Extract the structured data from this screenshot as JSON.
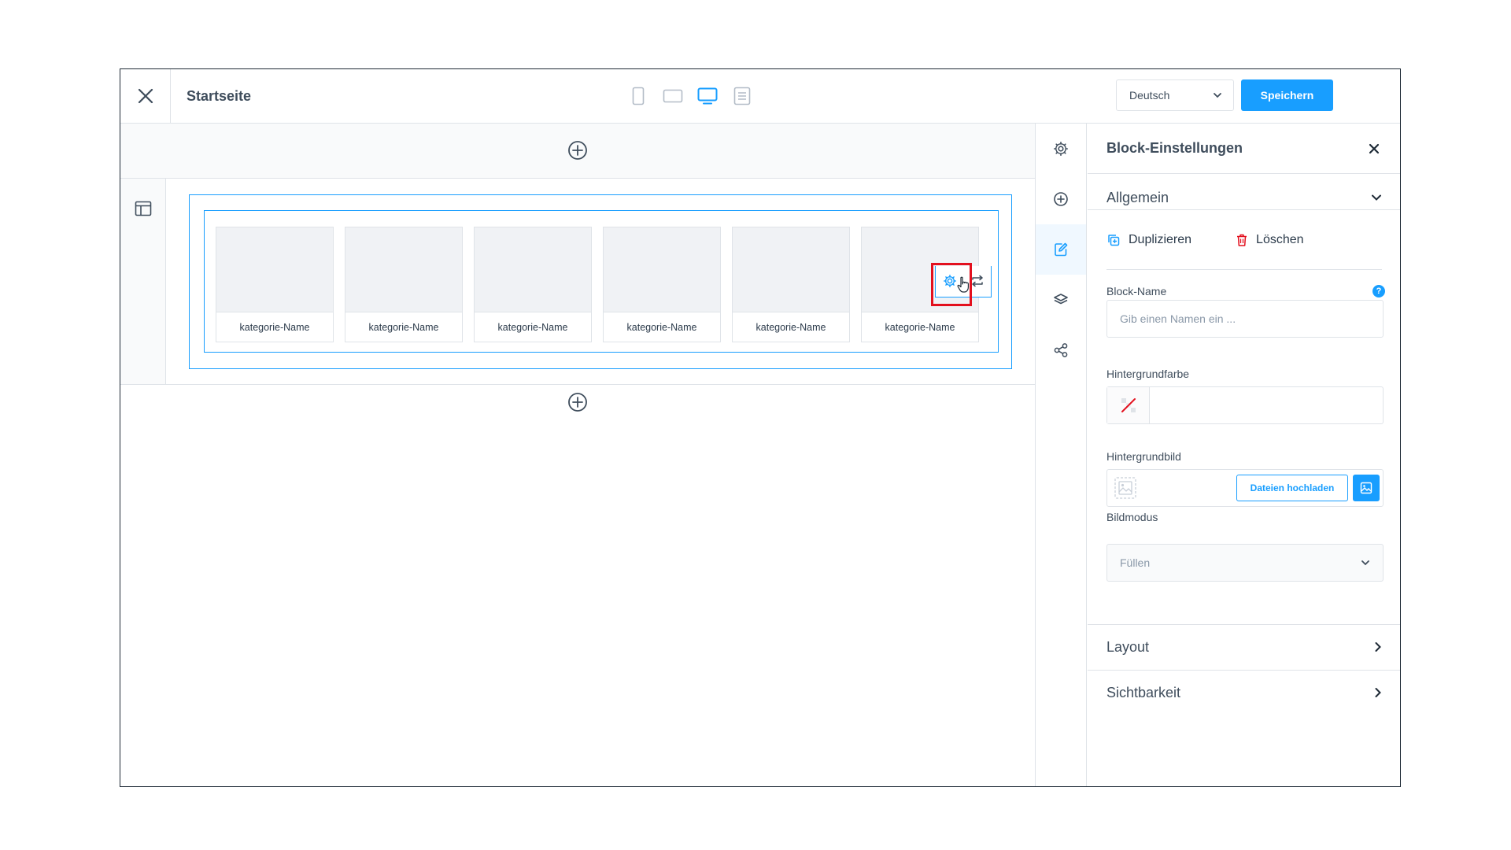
{
  "header": {
    "title": "Startseite",
    "language": "Deutsch",
    "save_label": "Speichern",
    "devices": [
      "mobile-icon",
      "tablet-icon",
      "desktop-icon",
      "list-view-icon"
    ],
    "active_device": "desktop-icon"
  },
  "canvas": {
    "categories": [
      {
        "name": "kategorie-Name"
      },
      {
        "name": "kategorie-Name"
      },
      {
        "name": "kategorie-Name"
      },
      {
        "name": "kategorie-Name"
      },
      {
        "name": "kategorie-Name"
      },
      {
        "name": "kategorie-Name"
      }
    ]
  },
  "sidebar_icons": [
    "settings-icon",
    "add-icon",
    "edit-block-icon",
    "layers-icon",
    "share-icon"
  ],
  "sidebar_active": "edit-block-icon",
  "panel": {
    "title": "Block-Einstellungen",
    "general": {
      "label": "Allgemein",
      "duplicate_label": "Duplizieren",
      "delete_label": "Löschen",
      "block_name_label": "Block-Name",
      "block_name_placeholder": "Gib einen Namen ein ...",
      "block_name_value": "",
      "bg_color_label": "Hintergrundfarbe",
      "bg_color_value": "",
      "bg_image_label": "Hintergrundbild",
      "upload_label": "Dateien hochladen",
      "image_mode_label": "Bildmodus",
      "image_mode_value": "Füllen"
    },
    "layout_label": "Layout",
    "visibility_label": "Sichtbarkeit"
  },
  "colors": {
    "accent": "#189eff",
    "highlight": "#e3101e",
    "danger": "#e3101e",
    "border": "#dfe3e8"
  }
}
